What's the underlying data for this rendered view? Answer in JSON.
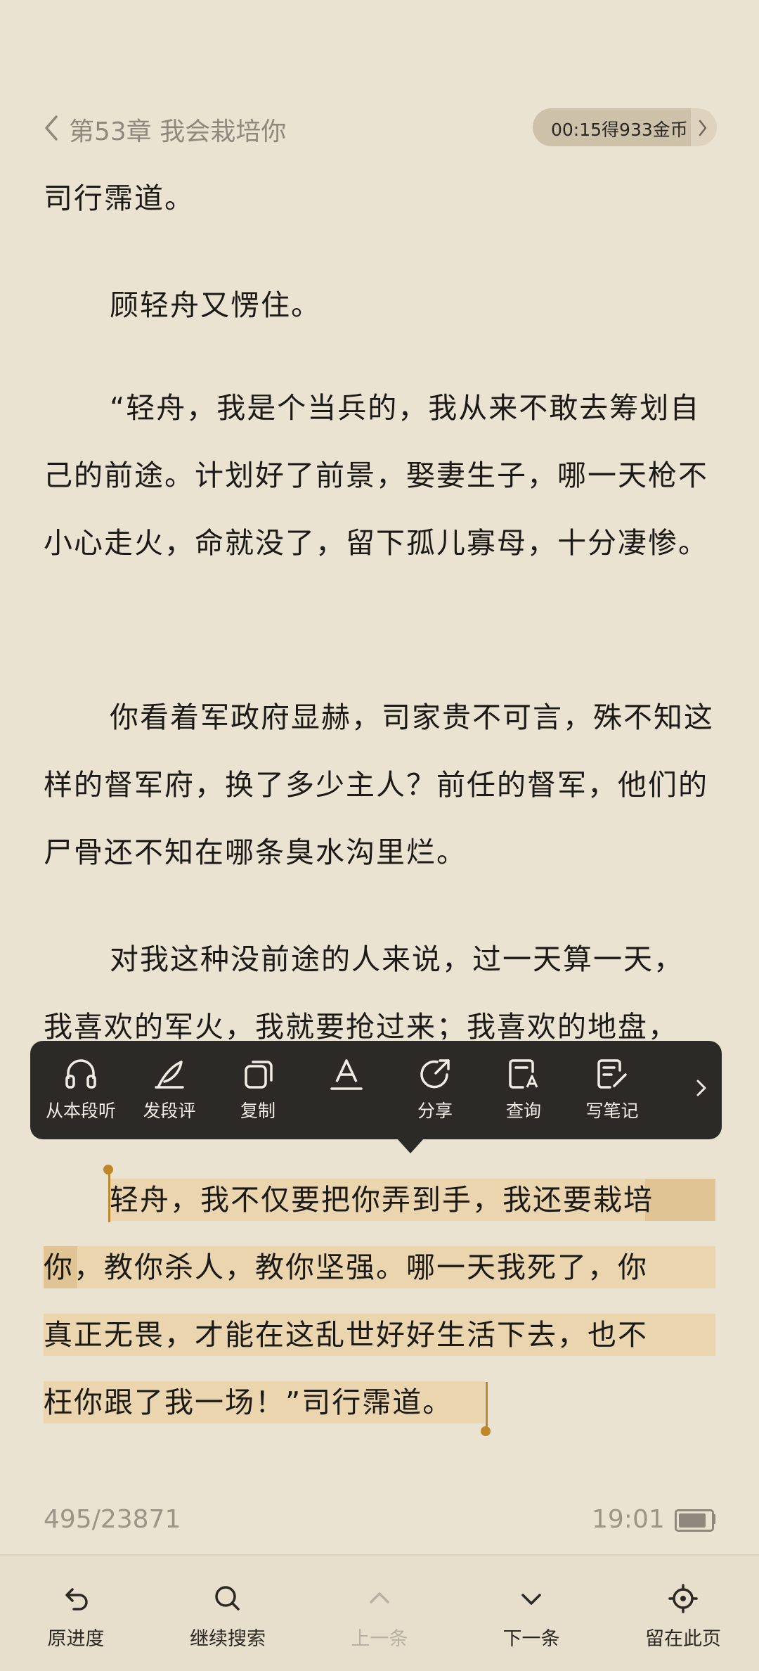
{
  "header": {
    "chapter_title": "第53章 我会栽培你",
    "timer_text": "00:15得933金币"
  },
  "content": {
    "p1": "司行霈道。",
    "p2": "顾轻舟又愣住。",
    "p3": "“轻舟，我是个当兵的，我从来不敢去筹划自己的前途。计划好了前景，娶妻生子，哪一天枪不小心走火，命就没了，留下孤儿寡母，十分凄惨。",
    "p4": "你看着军政府显赫，司家贵不可言，殊不知这样的督军府，换了多少主人？前任的督军，他们的尸骨还不知在哪条臭水沟里烂。",
    "p5a": "对我这种没前途的人来说，过一天算一天，",
    "p5b": "我喜欢的军火，我就要抢过来；我喜欢的地盘，",
    "p6_l1": "轻舟，我不仅要把你弄到手，我还要栽培",
    "p6_l2": "你，教你杀人，教你坚强。哪一天我死了，你",
    "p6_l3": "真正无畏，才能在这乱世好好生活下去，也不",
    "p6_l4": "枉你跟了我一场！”司行霈道。"
  },
  "toolbar": {
    "items": [
      {
        "label": "从本段听",
        "icon": "headphones-icon"
      },
      {
        "label": "发段评",
        "icon": "feather-icon"
      },
      {
        "label": "复制",
        "icon": "copy-icon"
      },
      {
        "label": "",
        "icon": "text-underline-icon"
      },
      {
        "label": "分享",
        "icon": "share-icon"
      },
      {
        "label": "查询",
        "icon": "lookup-icon"
      },
      {
        "label": "写笔记",
        "icon": "note-icon"
      }
    ]
  },
  "status": {
    "progress": "495/23871",
    "time": "19:01",
    "battery_level": 0.9
  },
  "bottom_bar": {
    "items": [
      {
        "label": "原进度",
        "icon": "undo-icon"
      },
      {
        "label": "继续搜索",
        "icon": "search-icon"
      },
      {
        "label": "上一条",
        "icon": "chevron-up-icon"
      },
      {
        "label": "下一条",
        "icon": "chevron-down-icon"
      },
      {
        "label": "留在此页",
        "icon": "locate-icon"
      }
    ]
  },
  "colors": {
    "background": "#ebe3d1",
    "highlight": "#ead5ae",
    "accent": "#c0872a",
    "popup": "#2b2a27"
  }
}
